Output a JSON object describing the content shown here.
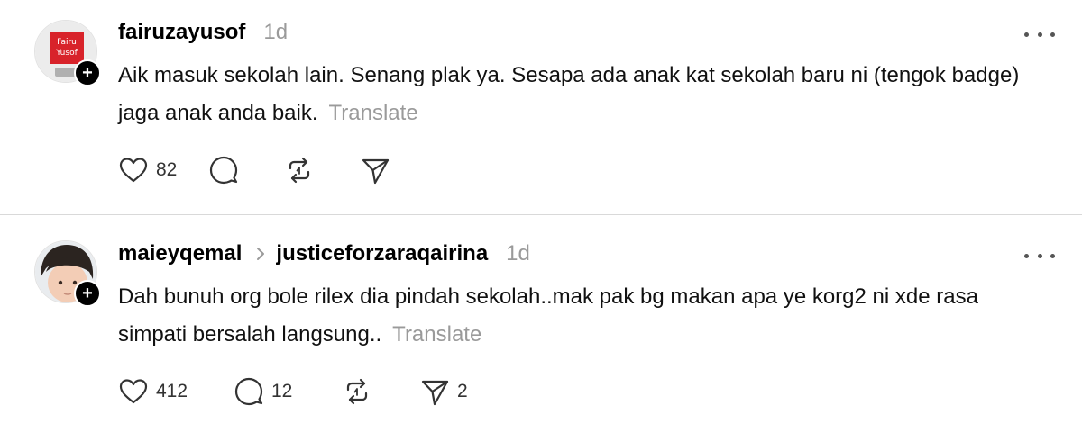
{
  "posts": [
    {
      "username": "fairuzayusof",
      "time": "1d",
      "text": "Aik masuk sekolah lain. Senang plak ya. Sesapa ada anak kat sekolah baru ni (tengok badge) jaga anak anda baik.",
      "translate": "Translate",
      "likes": "82",
      "avatar_icon": "profile-logo",
      "accent_color": "#d8232a"
    },
    {
      "username": "maieyqemal",
      "reply_to": "justiceforzaraqairina",
      "time": "1d",
      "text": "Dah bunuh org bole rilex dia pindah sekolah..mak pak bg makan apa ye korg2 ni xde rasa simpati bersalah langsung..",
      "translate": "Translate",
      "likes": "412",
      "replies": "12",
      "shares": "2",
      "avatar_icon": "child-photo"
    }
  ]
}
